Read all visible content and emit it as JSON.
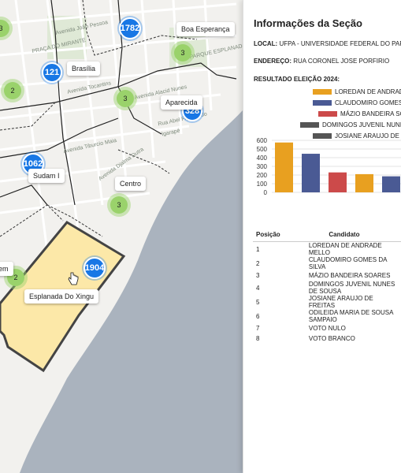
{
  "map": {
    "clusters_blue": [
      {
        "name": "cluster-1782",
        "count": "1782"
      },
      {
        "name": "cluster-121",
        "count": "121"
      },
      {
        "name": "cluster-1062",
        "count": "1062"
      },
      {
        "name": "cluster-1904",
        "count": "1904"
      },
      {
        "name": "cluster-328",
        "count": "328"
      }
    ],
    "clusters_green": [
      {
        "count": "3"
      },
      {
        "count": "2"
      },
      {
        "count": "3"
      },
      {
        "count": "3"
      },
      {
        "count": "2"
      },
      {
        "count": "3"
      }
    ],
    "tooltips": {
      "boa_esperanca": "Boa Esperança",
      "brasilia": "Brasília",
      "aparecida": "Aparecida",
      "sudam": "Sudam I",
      "centro": "Centro",
      "esplanada": "Esplanada Do Xingu",
      "em": "em"
    },
    "street_labels": {
      "praca": "PRAÇA DO MIRANTE",
      "parque": "PARQUE ESPLANADA",
      "av_joao": "Avenida João Pessoa",
      "av_tocantins": "Avenida Tocantins",
      "av_alacid": "Avenida Alacid Nunes",
      "rua_abel": "Rua Abel Figueiredo",
      "av_tiburcio": "Avenida Tiburcio Maia",
      "av_djalma": "Avenida Djalma Dutra",
      "igarape": "Igarapé"
    }
  },
  "panel": {
    "title": "Informações da Seção",
    "local_label": "LOCAL:",
    "local_value": "UFPA - UNIVERSIDADE FEDERAL DO PARÁ",
    "endereco_label": "ENDEREÇO:",
    "endereco_value": "RUA CORONEL JOSE PORFIRIO",
    "resultado_label": "RESULTADO ELEIÇÃO 2024:"
  },
  "chart_data": {
    "type": "bar",
    "series": [
      {
        "name": "LOREDAN DE ANDRADE MELLO",
        "value": 575,
        "color": "#e8a020"
      },
      {
        "name": "CLAUDOMIRO GOMES DA SILVA",
        "value": 445,
        "color": "#4a5a94"
      },
      {
        "name": "MÁZIO BANDEIRA SOARES",
        "value": 230,
        "color": "#cc4a4a"
      },
      {
        "name": "DOMINGOS JUVENIL NUNES DE SOUSA",
        "value": 210,
        "color": "#e8a020"
      },
      {
        "name": "JOSIANE ARAUJO DE FREITAS",
        "value": 185,
        "color": "#4a5a94"
      }
    ],
    "legend_labels": [
      "LOREDAN DE ANDRADE MELLO",
      "CLAUDOMIRO GOMES DA SILVA",
      "MÁZIO BANDEIRA SOARES",
      "DOMINGOS JUVENIL NUNES DE SOUSA",
      "JOSIANE ARAUJO DE FREITAS"
    ],
    "legend_colors": [
      "#e8a020",
      "#4a5a94",
      "#cc4a4a",
      "#555555",
      "#555555"
    ],
    "yticks": [
      0,
      100,
      200,
      300,
      400,
      500,
      600
    ],
    "ylim": [
      0,
      600
    ],
    "grid": true
  },
  "table": {
    "headers": [
      "Posição",
      "Candidato"
    ],
    "rows": [
      [
        "1",
        "LOREDAN DE ANDRADE MELLO"
      ],
      [
        "2",
        "CLAUDOMIRO GOMES DA SILVA"
      ],
      [
        "3",
        "MÁZIO BANDEIRA SOARES"
      ],
      [
        "4",
        "DOMINGOS JUVENIL NUNES DE SOUSA"
      ],
      [
        "5",
        "JOSIANE ARAUJO DE FREITAS"
      ],
      [
        "6",
        "ODILEIDA MARIA DE SOUSA SAMPAIO"
      ],
      [
        "7",
        "VOTO NULO"
      ],
      [
        "8",
        "VOTO BRANCO"
      ]
    ]
  }
}
